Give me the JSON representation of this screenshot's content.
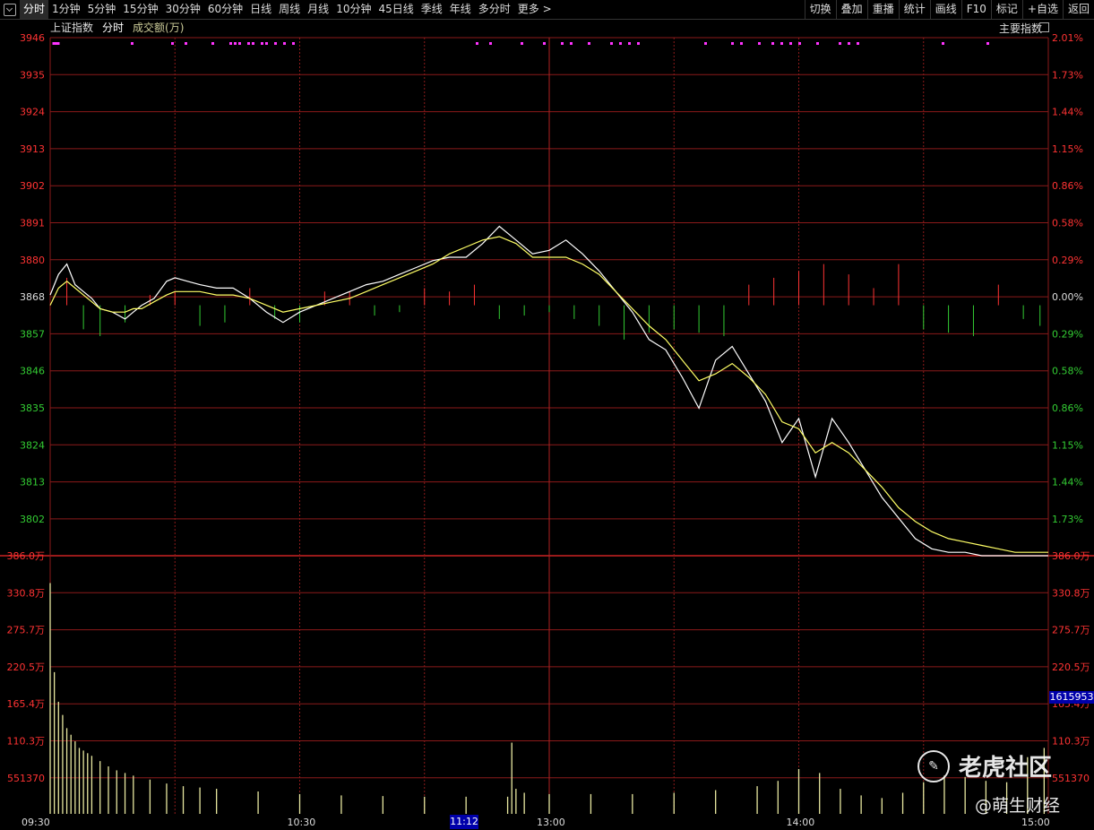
{
  "toolbar": {
    "left_items": [
      "分时",
      "1分钟",
      "5分钟",
      "15分钟",
      "30分钟",
      "60分钟",
      "日线",
      "周线",
      "月线",
      "10分钟",
      "45日线",
      "季线",
      "年线",
      "多分时",
      "更多 >"
    ],
    "right_items": [
      "切换",
      "叠加",
      "重播",
      "统计",
      "画线",
      "F10",
      "标记",
      "+自选",
      "返回"
    ]
  },
  "header": {
    "title": "上证指数",
    "tab": "分时",
    "volume_label": "成交额(万)",
    "index_button": "主要指数"
  },
  "cursor": {
    "time": "11:12",
    "value": "1615953"
  },
  "watermark": {
    "brand": "老虎社区",
    "author": "@萌生财经"
  },
  "colors": {
    "price_line": "#ffffff",
    "avg_line": "#ffff66",
    "up": "#ff3333",
    "down": "#33cc33",
    "grid": "#8b1a1a",
    "axis_red": "#ff3333",
    "axis_green": "#33cc33"
  },
  "chart_data": {
    "type": "line",
    "title": "上证指数 分时",
    "x_ticks": [
      "09:30",
      "10:30",
      "13:00",
      "14:00",
      "15:00"
    ],
    "ylim": [
      3795,
      3946
    ],
    "base": 3868,
    "price_axis_left": [
      "3946",
      "3935",
      "3924",
      "3913",
      "3902",
      "3891",
      "3880",
      "3868",
      "3857",
      "3846",
      "3835",
      "3824",
      "3813",
      "3802"
    ],
    "pct_axis_right": [
      "2.01%",
      "1.73%",
      "1.44%",
      "1.15%",
      "0.86%",
      "0.58%",
      "0.29%",
      "0.00%",
      "0.29%",
      "0.58%",
      "0.86%",
      "1.15%",
      "1.44%",
      "1.73%"
    ],
    "volume_axis_left": [
      "386.0万",
      "330.8万",
      "275.7万",
      "220.5万",
      "165.4万",
      "110.3万",
      "551370"
    ],
    "volume_axis_right": [
      "386.0万",
      "330.8万",
      "275.7万",
      "220.5万",
      "165.4万",
      "110.3万",
      "551370"
    ],
    "series": [
      {
        "name": "price",
        "x": [
          0,
          2,
          4,
          6,
          8,
          10,
          12,
          15,
          18,
          20,
          22,
          25,
          28,
          30,
          33,
          36,
          40,
          44,
          48,
          52,
          56,
          60,
          64,
          68,
          72,
          76,
          80,
          84,
          88,
          92,
          96,
          100,
          104,
          108,
          112,
          116,
          120,
          124,
          128,
          132,
          136,
          140,
          144,
          148,
          152,
          156,
          160,
          164,
          168,
          172,
          176,
          180,
          184,
          188,
          192,
          196,
          200,
          204,
          208,
          212,
          216,
          220,
          224,
          228,
          232,
          236,
          240
        ],
        "y": [
          3871,
          3877,
          3880,
          3874,
          3872,
          3870,
          3867,
          3866,
          3864,
          3866,
          3868,
          3870,
          3875,
          3876,
          3875,
          3874,
          3873,
          3873,
          3870,
          3866,
          3863,
          3866,
          3868,
          3870,
          3872,
          3874,
          3875,
          3877,
          3879,
          3881,
          3882,
          3882,
          3886,
          3891,
          3887,
          3883,
          3884,
          3887,
          3883,
          3878,
          3872,
          3866,
          3858,
          3855,
          3847,
          3838,
          3852,
          3856,
          3848,
          3840,
          3828,
          3835,
          3818,
          3835,
          3828,
          3820,
          3812,
          3806,
          3800,
          3797,
          3796,
          3796,
          3795,
          3795,
          3795,
          3795,
          3795
        ]
      },
      {
        "name": "avg",
        "x": [
          0,
          2,
          4,
          6,
          8,
          10,
          12,
          15,
          18,
          20,
          22,
          25,
          28,
          30,
          33,
          36,
          40,
          44,
          48,
          52,
          56,
          60,
          64,
          68,
          72,
          76,
          80,
          84,
          88,
          92,
          96,
          100,
          104,
          108,
          112,
          116,
          120,
          124,
          128,
          132,
          136,
          140,
          144,
          148,
          152,
          156,
          160,
          164,
          168,
          172,
          176,
          180,
          184,
          188,
          192,
          196,
          200,
          204,
          208,
          212,
          216,
          220,
          224,
          228,
          232,
          236,
          240
        ],
        "y": [
          3868,
          3873,
          3875,
          3873,
          3871,
          3869,
          3867,
          3866,
          3866,
          3867,
          3867,
          3869,
          3871,
          3872,
          3872,
          3872,
          3871,
          3871,
          3870,
          3868,
          3866,
          3867,
          3868,
          3869,
          3870,
          3872,
          3874,
          3876,
          3878,
          3880,
          3883,
          3885,
          3887,
          3888,
          3886,
          3882,
          3882,
          3882,
          3880,
          3877,
          3872,
          3867,
          3862,
          3858,
          3852,
          3846,
          3848,
          3851,
          3847,
          3842,
          3834,
          3832,
          3825,
          3828,
          3825,
          3820,
          3815,
          3809,
          3805,
          3802,
          3800,
          3799,
          3798,
          3797,
          3796,
          3796,
          3796
        ]
      }
    ],
    "pressure_bars": {
      "note": "red above / green below baseline, values in index points",
      "x": [
        4,
        8,
        12,
        18,
        24,
        30,
        36,
        42,
        48,
        54,
        60,
        66,
        72,
        78,
        84,
        90,
        96,
        102,
        108,
        114,
        120,
        126,
        132,
        138,
        144,
        150,
        156,
        162,
        168,
        174,
        180,
        186,
        192,
        198,
        204,
        210,
        216,
        222,
        228,
        234,
        238
      ],
      "values": [
        8,
        -7,
        -9,
        -5,
        3,
        4,
        -6,
        -5,
        5,
        -4,
        -5,
        4,
        4,
        -3,
        -2,
        5,
        4,
        6,
        -4,
        -3,
        -2,
        -4,
        -6,
        -10,
        -8,
        -7,
        -8,
        -9,
        6,
        8,
        10,
        12,
        9,
        5,
        12,
        -7,
        -8,
        -9,
        6,
        -4,
        -6
      ]
    },
    "volume": {
      "unit": "万",
      "x": [
        0,
        1,
        2,
        3,
        4,
        5,
        6,
        7,
        8,
        9,
        10,
        12,
        14,
        16,
        18,
        20,
        24,
        28,
        32,
        36,
        40,
        50,
        60,
        70,
        80,
        90,
        100,
        110,
        111,
        112,
        114,
        120,
        130,
        140,
        150,
        160,
        170,
        175,
        180,
        185,
        190,
        195,
        200,
        205,
        210,
        215,
        220,
        225,
        230,
        235,
        239
      ],
      "values": [
        3500,
        2150,
        1700,
        1500,
        1300,
        1200,
        1100,
        1000,
        960,
        920,
        880,
        800,
        720,
        660,
        620,
        580,
        520,
        460,
        420,
        400,
        380,
        340,
        300,
        280,
        270,
        260,
        260,
        260,
        1080,
        380,
        320,
        300,
        300,
        300,
        320,
        360,
        420,
        500,
        680,
        620,
        380,
        280,
        240,
        320,
        480,
        580,
        560,
        500,
        480,
        860,
        1000
      ]
    }
  }
}
